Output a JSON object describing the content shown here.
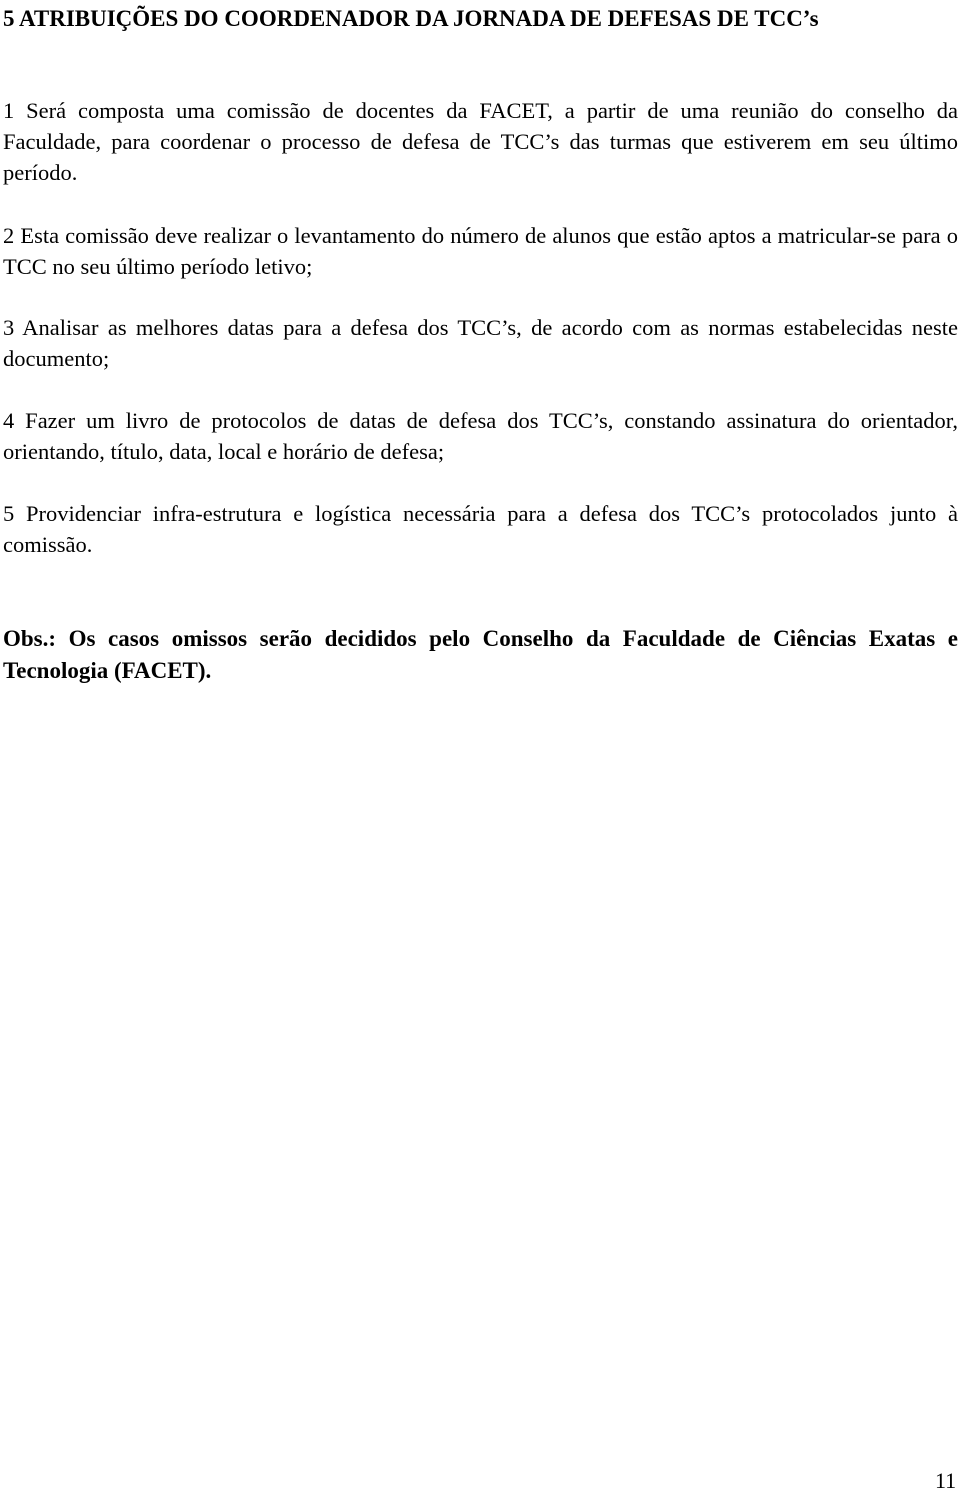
{
  "document": {
    "section_heading": "5 ATRIBUIÇÕES DO COORDENADOR DA JORNADA DE DEFESAS DE TCC’s",
    "items": [
      {
        "text": "1 Será composta uma comissão de docentes da FACET, a partir de uma reunião do conselho da Faculdade, para coordenar o processo de defesa de TCC’s das turmas que estiverem em seu último período."
      },
      {
        "text": "2 Esta comissão deve realizar o levantamento do  número de alunos que estão aptos a matricular-se para o TCC no seu último período letivo;"
      },
      {
        "text": "3 Analisar as melhores datas para a defesa dos TCC’s, de acordo com as normas estabelecidas neste documento;"
      },
      {
        "text": "4 Fazer um livro de protocolos de datas de defesa dos TCC’s, constando assinatura do orientador, orientando, título, data, local e horário de defesa;"
      },
      {
        "text": "5 Providenciar infra-estrutura e logística necessária para a defesa dos TCC’s protocolados junto à comissão."
      }
    ],
    "obs": {
      "label": "Obs.:",
      "text": " Os casos omissos serão decididos pelo Conselho da Faculdade de Ciências Exatas e Tecnologia (FACET)."
    },
    "page_number": "11"
  }
}
